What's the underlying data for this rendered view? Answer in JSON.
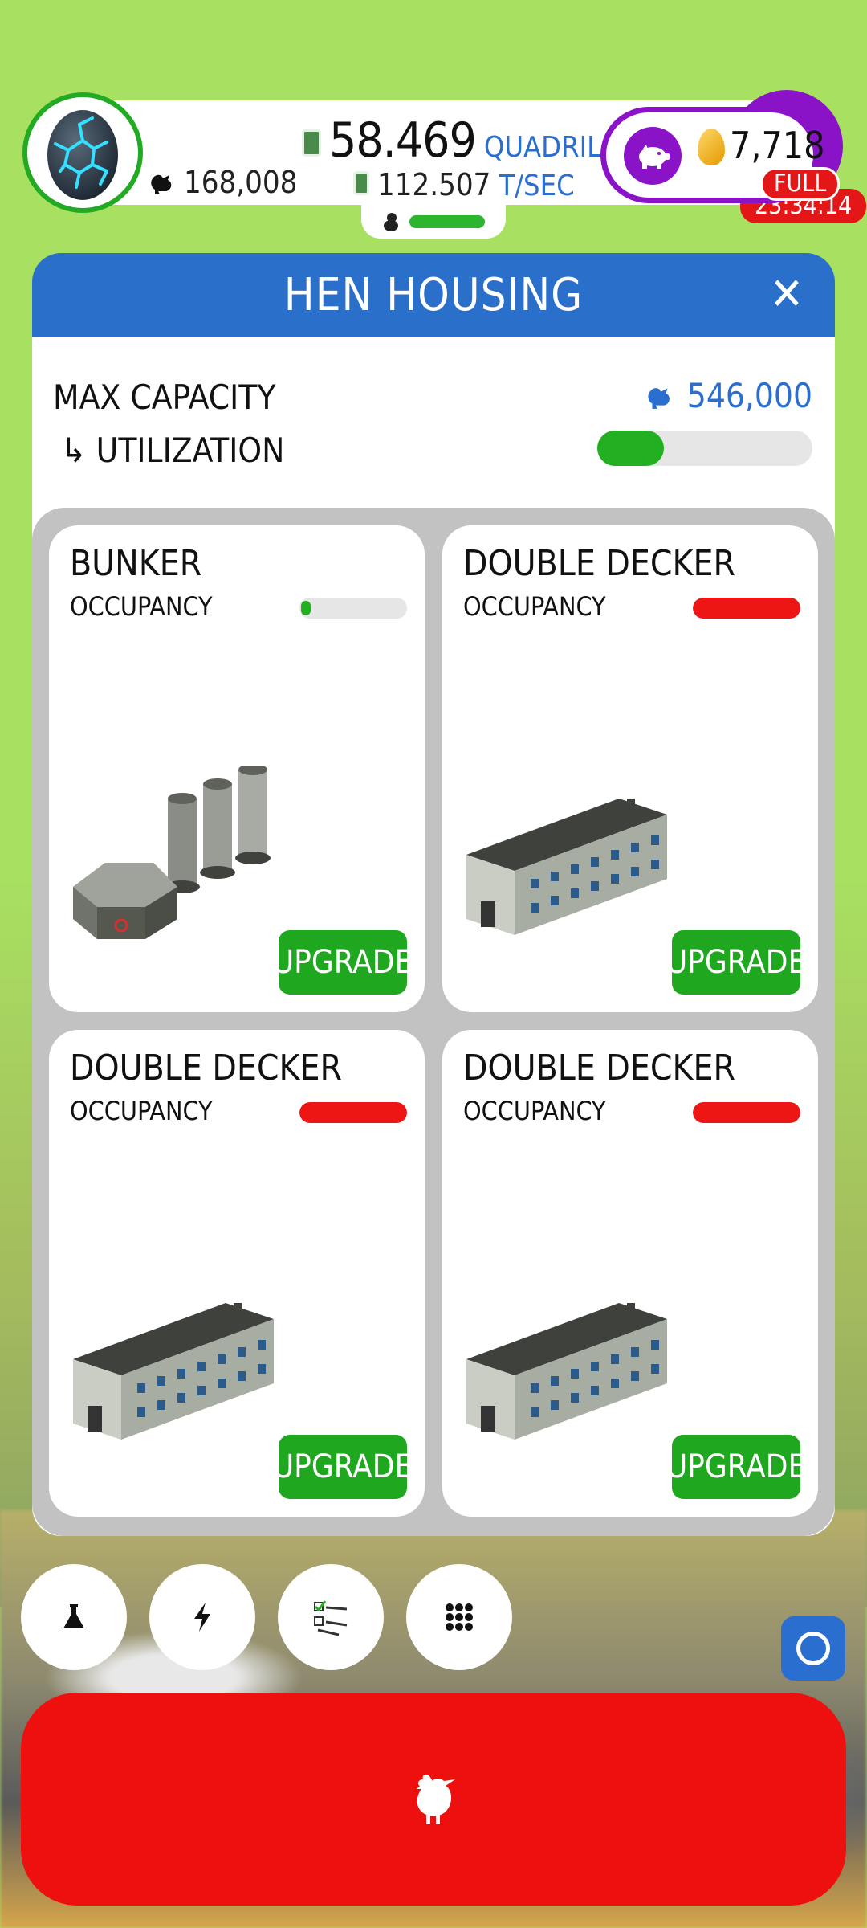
{
  "hud": {
    "chicken_count": "168,008",
    "cash_amount": "58.469",
    "cash_unit": "QUADRILLION",
    "cash_rate": "112.507",
    "cash_rate_unit": "T/SEC",
    "golden_eggs": "7,718",
    "piggy_status": "FULL",
    "timer": "23:34:14"
  },
  "modal": {
    "title": "HEN HOUSING",
    "max_capacity_label": "MAX CAPACITY",
    "max_capacity_value": "546,000",
    "utilization_label": "↳ UTILIZATION",
    "utilization_fraction": 0.31
  },
  "houses": [
    {
      "name": "BUNKER",
      "occupancy_label": "OCCUPANCY",
      "occupancy_fraction": 0.08,
      "occupancy_color": "#22b022",
      "button": "UPGRADE",
      "image": "bunker"
    },
    {
      "name": "DOUBLE DECKER",
      "occupancy_label": "OCCUPANCY",
      "occupancy_fraction": 1.0,
      "occupancy_color": "#ee1515",
      "button": "UPGRADE",
      "image": "double-decker"
    },
    {
      "name": "DOUBLE DECKER",
      "occupancy_label": "OCCUPANCY",
      "occupancy_fraction": 1.0,
      "occupancy_color": "#ee1515",
      "button": "UPGRADE",
      "image": "double-decker"
    },
    {
      "name": "DOUBLE DECKER",
      "occupancy_label": "OCCUPANCY",
      "occupancy_fraction": 1.0,
      "occupancy_color": "#ee1515",
      "button": "UPGRADE",
      "image": "double-decker"
    }
  ],
  "toolbar": {
    "buttons": [
      "research-flask-icon",
      "boost-lightning-icon",
      "missions-checklist-icon",
      "menu-grid-icon"
    ]
  },
  "colors": {
    "accent_blue": "#2a6fc9",
    "upgrade_green": "#1fa81f",
    "hatch_red": "#ee0f0f",
    "premium_purple": "#8a12c7"
  }
}
